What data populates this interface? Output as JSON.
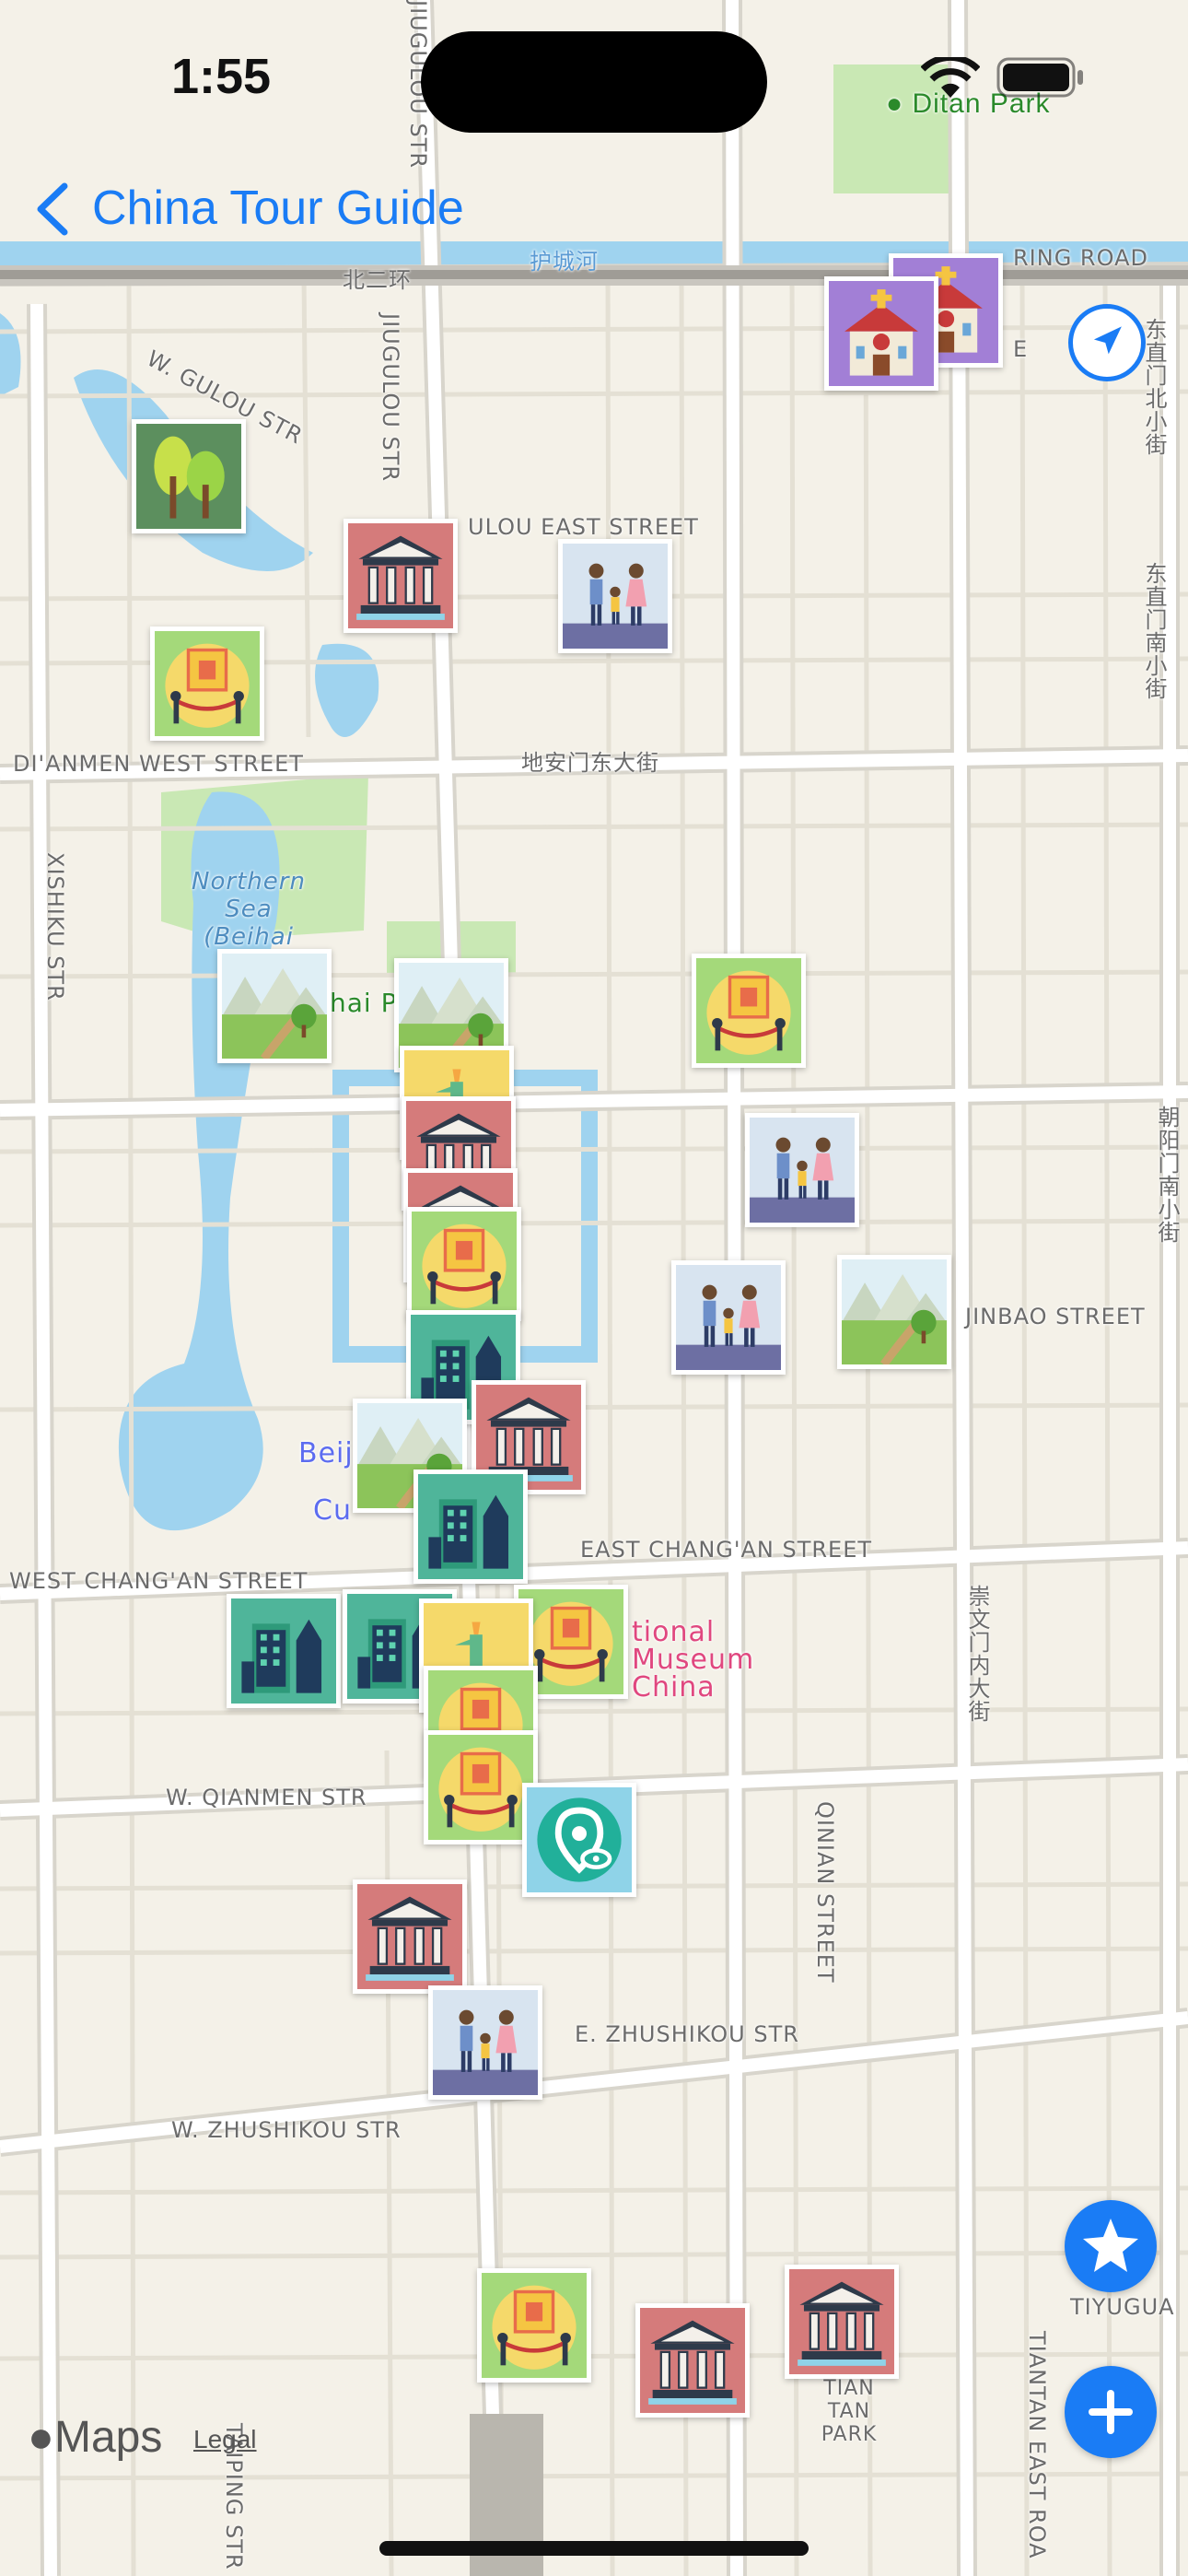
{
  "status_bar": {
    "time": "1:55"
  },
  "nav": {
    "title": "China Tour Guide"
  },
  "map": {
    "street_labels": [
      {
        "text": "JIUGULOU STR"
      },
      {
        "text": "RING ROAD"
      },
      {
        "text": "北二环"
      },
      {
        "text": "护城河"
      },
      {
        "text": "JIUGULOU STR"
      },
      {
        "text": "W. GULOU STR"
      },
      {
        "text": "ULOU EAST STREET"
      },
      {
        "text": "东直门北小街"
      },
      {
        "text": "东直门南小街"
      },
      {
        "text": "DI'ANMEN WEST STREET"
      },
      {
        "text": "地安门东大街"
      },
      {
        "text": "XISHIKU STR"
      },
      {
        "text": "朝阳门南小街"
      },
      {
        "text": "JINBAO STREET"
      },
      {
        "text": "EAST CHANG'AN STREET"
      },
      {
        "text": "WEST CHANG'AN STREET"
      },
      {
        "text": "崇文门内大街"
      },
      {
        "text": "W. QIANMEN STR"
      },
      {
        "text": "QINIAN STREET"
      },
      {
        "text": "E. ZHUSHIKOU STR"
      },
      {
        "text": "W. ZHUSHIKOU STR"
      },
      {
        "text": "TIYUGUA"
      },
      {
        "text": "TIANTAN EAST ROA"
      },
      {
        "text": "TAIPING STR"
      },
      {
        "text": "TIAN TAN PARK"
      },
      {
        "text": "E"
      }
    ],
    "poi_labels": {
      "ditan_park": "Ditan Park",
      "northern_sea": "Northern Sea (Beihai L...",
      "beihai_park": "hai P",
      "museum": "tional Museum China",
      "beiji": "Beiji",
      "cu": "Cu"
    },
    "colors": {
      "water": "#9fd3ef",
      "park": "#c9e8b4",
      "road": "#ffffff",
      "road_edge": "#d8d5cc",
      "accent": "#1a7cf5"
    }
  },
  "pins": [
    {
      "icon": "church"
    },
    {
      "icon": "church"
    },
    {
      "icon": "tree"
    },
    {
      "icon": "museum"
    },
    {
      "icon": "family"
    },
    {
      "icon": "exhibit"
    },
    {
      "icon": "landscape"
    },
    {
      "icon": "landscape"
    },
    {
      "icon": "exhibit"
    },
    {
      "icon": "family"
    },
    {
      "icon": "family"
    },
    {
      "icon": "landscape"
    },
    {
      "icon": "museum"
    },
    {
      "icon": "skyscraper"
    },
    {
      "icon": "museum"
    },
    {
      "icon": "landscape"
    },
    {
      "icon": "skyscraper"
    },
    {
      "icon": "skyscraper"
    },
    {
      "icon": "skyscraper"
    },
    {
      "icon": "liberty"
    },
    {
      "icon": "exhibit"
    },
    {
      "icon": "exhibit"
    },
    {
      "icon": "location-eye"
    },
    {
      "icon": "museum"
    },
    {
      "icon": "family"
    },
    {
      "icon": "exhibit"
    },
    {
      "icon": "museum"
    },
    {
      "icon": "museum"
    }
  ],
  "footer": {
    "maps_brand": "Maps",
    "legal": "Legal"
  }
}
